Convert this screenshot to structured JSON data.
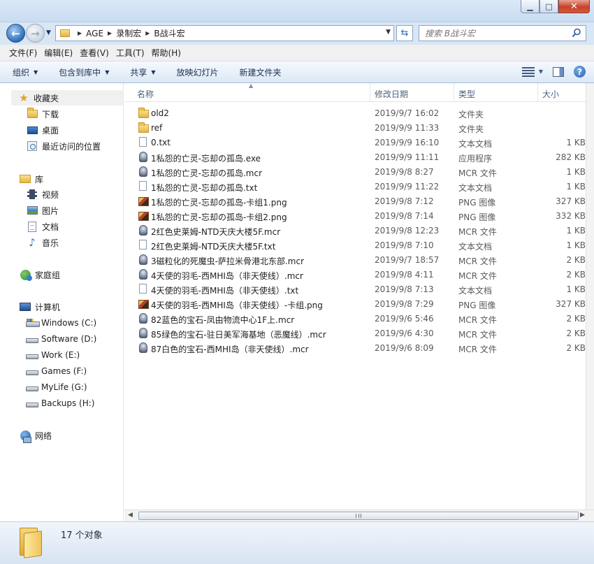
{
  "window": {
    "min_glyph": "▁",
    "max_glyph": "□",
    "close_glyph": "✕"
  },
  "address": {
    "crumbs": [
      "AGE",
      "录制宏",
      "B战斗宏"
    ]
  },
  "search": {
    "placeholder": "搜索 B战斗宏"
  },
  "menu": [
    "文件(F)",
    "编辑(E)",
    "查看(V)",
    "工具(T)",
    "帮助(H)"
  ],
  "commands": {
    "organize": "组织",
    "include": "包含到库中",
    "share": "共享",
    "slideshow": "放映幻灯片",
    "newfolder": "新建文件夹"
  },
  "nav": {
    "favorites": "收藏夹",
    "downloads": "下载",
    "desktop": "桌面",
    "recent": "最近访问的位置",
    "libraries": "库",
    "videos": "视频",
    "pictures": "图片",
    "documents": "文档",
    "music": "音乐",
    "homegroup": "家庭组",
    "computer": "计算机",
    "drives": [
      "Windows (C:)",
      "Software (D:)",
      "Work (E:)",
      "Games (F:)",
      "MyLife (G:)",
      "Backups (H:)"
    ],
    "network": "网络"
  },
  "columns": {
    "name": "名称",
    "date": "修改日期",
    "type": "类型",
    "size": "大小"
  },
  "files": [
    {
      "name": "old2",
      "date": "2019/9/7 16:02",
      "type": "文件夹",
      "size": "",
      "icon": "folder"
    },
    {
      "name": "ref",
      "date": "2019/9/9 11:33",
      "type": "文件夹",
      "size": "",
      "icon": "folder"
    },
    {
      "name": "0.txt",
      "date": "2019/9/9 16:10",
      "type": "文本文档",
      "size": "1 KB",
      "icon": "txt"
    },
    {
      "name": "1私怨的亡灵-忘却の孤岛.exe",
      "date": "2019/9/9 11:11",
      "type": "应用程序",
      "size": "282 KB",
      "icon": "mcr"
    },
    {
      "name": "1私怨的亡灵-忘却の孤岛.mcr",
      "date": "2019/9/8 8:27",
      "type": "MCR 文件",
      "size": "1 KB",
      "icon": "mcr"
    },
    {
      "name": "1私怨的亡灵-忘却の孤岛.txt",
      "date": "2019/9/9 11:22",
      "type": "文本文档",
      "size": "1 KB",
      "icon": "txt"
    },
    {
      "name": "1私怨的亡灵-忘却の孤岛-卡组1.png",
      "date": "2019/9/8 7:12",
      "type": "PNG 图像",
      "size": "327 KB",
      "icon": "png"
    },
    {
      "name": "1私怨的亡灵-忘却の孤岛-卡组2.png",
      "date": "2019/9/8 7:14",
      "type": "PNG 图像",
      "size": "332 KB",
      "icon": "png"
    },
    {
      "name": "2红色史莱姆-NTD天庆大楼5F.mcr",
      "date": "2019/9/8 12:23",
      "type": "MCR 文件",
      "size": "1 KB",
      "icon": "mcr"
    },
    {
      "name": "2红色史莱姆-NTD天庆大楼5F.txt",
      "date": "2019/9/8 7:10",
      "type": "文本文档",
      "size": "1 KB",
      "icon": "txt"
    },
    {
      "name": "3磁粒化的死魔虫-萨拉米骨港北东部.mcr",
      "date": "2019/9/7 18:57",
      "type": "MCR 文件",
      "size": "2 KB",
      "icon": "mcr"
    },
    {
      "name": "4天使的羽毛-西MHI岛（非天使线）.mcr",
      "date": "2019/9/8 4:11",
      "type": "MCR 文件",
      "size": "2 KB",
      "icon": "mcr"
    },
    {
      "name": "4天使的羽毛-西MHI岛（非天使线）.txt",
      "date": "2019/9/8 7:13",
      "type": "文本文档",
      "size": "1 KB",
      "icon": "txt"
    },
    {
      "name": "4天使的羽毛-西MHI岛（非天使线）-卡组.png",
      "date": "2019/9/8 7:29",
      "type": "PNG 图像",
      "size": "327 KB",
      "icon": "png"
    },
    {
      "name": "82蓝色的宝石-凤由物流中心1F上.mcr",
      "date": "2019/9/6 5:46",
      "type": "MCR 文件",
      "size": "2 KB",
      "icon": "mcr"
    },
    {
      "name": "85绿色的宝石-驻日美军海基地（恶魔线）.mcr",
      "date": "2019/9/6 4:30",
      "type": "MCR 文件",
      "size": "2 KB",
      "icon": "mcr"
    },
    {
      "name": "87白色的宝石-西MHI岛（非天使线）.mcr",
      "date": "2019/9/6 8:09",
      "type": "MCR 文件",
      "size": "2 KB",
      "icon": "mcr"
    }
  ],
  "status": {
    "count": "17 个对象"
  },
  "colors": {
    "chrome": "#d9e6f4",
    "selected_nav": "#f0f0f0"
  }
}
